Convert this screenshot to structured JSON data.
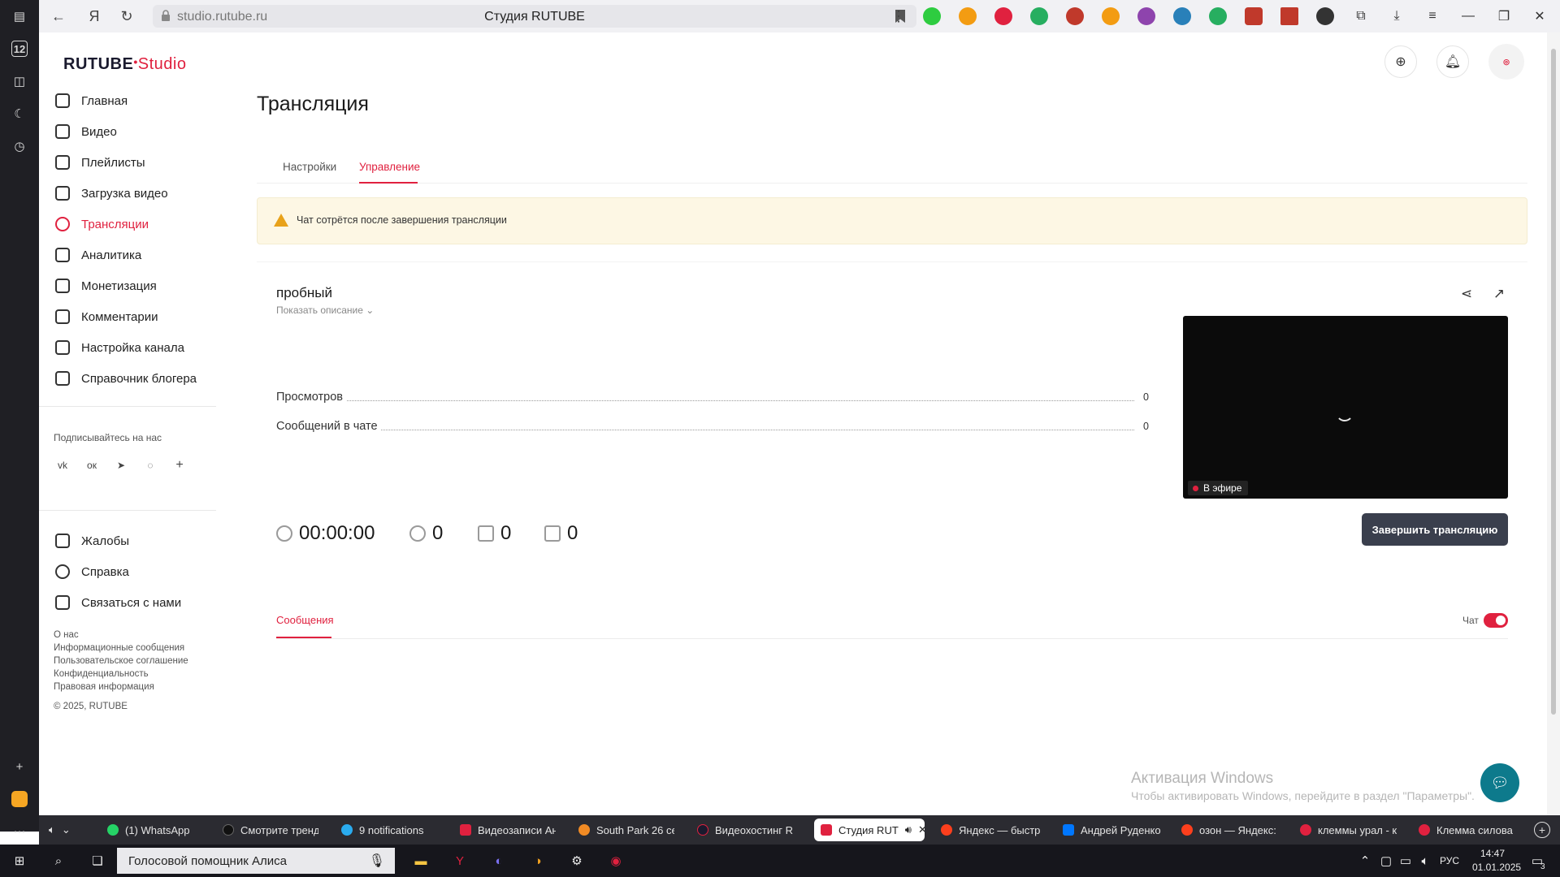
{
  "browser": {
    "url": "studio.rutube.ru",
    "title": "Студия RUTUBE",
    "rail_number": "12"
  },
  "logo": {
    "main": "RUTUBE",
    "suffix": "Studio"
  },
  "sidebar": {
    "items": [
      {
        "label": "Главная",
        "icon": "home-icon"
      },
      {
        "label": "Видео",
        "icon": "video-icon"
      },
      {
        "label": "Плейлисты",
        "icon": "playlist-icon"
      },
      {
        "label": "Загрузка видео",
        "icon": "upload-icon"
      },
      {
        "label": "Трансляции",
        "icon": "broadcast-icon",
        "active": true
      },
      {
        "label": "Аналитика",
        "icon": "analytics-icon"
      },
      {
        "label": "Монетизация",
        "icon": "monetization-icon"
      },
      {
        "label": "Комментарии",
        "icon": "comments-icon"
      },
      {
        "label": "Настройка канала",
        "icon": "settings-icon"
      },
      {
        "label": "Справочник блогера",
        "icon": "guide-icon"
      }
    ],
    "follow_title": "Подписывайтесь на нас",
    "social": [
      "vk",
      "ok",
      "telegram",
      "viber",
      "+"
    ],
    "bottom_items": [
      {
        "label": "Жалобы",
        "icon": "flag-icon"
      },
      {
        "label": "Справка",
        "icon": "help-icon"
      },
      {
        "label": "Связаться с нами",
        "icon": "mail-icon"
      }
    ],
    "footer_links": [
      "О нас",
      "Информационные сообщения",
      "Пользовательское соглашение",
      "Конфиденциальность",
      "Правовая информация"
    ],
    "copyright": "© 2025, RUTUBE"
  },
  "main": {
    "title": "Трансляция",
    "tabs": [
      "Настройки",
      "Управление"
    ],
    "active_tab": "Управление",
    "warning": "Чат сотрётся после завершения трансляции",
    "stream": {
      "name": "пробный",
      "show_description": "Показать описание",
      "stats": [
        {
          "label": "Просмотров",
          "value": "0"
        },
        {
          "label": "Сообщений в чате",
          "value": "0"
        }
      ],
      "duration": "00:00:00",
      "viewers": "0",
      "likes": "0",
      "dislikes": "0",
      "live_badge": "В эфире",
      "end_button": "Завершить трансляцию"
    },
    "messages": {
      "tab": "Сообщения",
      "chat_label": "Чат",
      "chat_enabled": true
    }
  },
  "watermark": {
    "line1": "Активация Windows",
    "line2": "Чтобы активировать Windows, перейдите в раздел \"Параметры\"."
  },
  "browser_tabs": [
    {
      "label": "(1) WhatsApp",
      "color": "#25d366"
    },
    {
      "label": "Смотрите тренд",
      "color": "#111111"
    },
    {
      "label": "9 notifications",
      "color": "#2aabee"
    },
    {
      "label": "Видеозаписи Ан",
      "color": "#e0213f"
    },
    {
      "label": "South Park 26 се",
      "color": "#f08a24"
    },
    {
      "label": "Видеохостинг RU",
      "color": "#1a1a2e"
    },
    {
      "label": "Студия RUT",
      "color": "#e0213f",
      "active": true
    },
    {
      "label": "Яндекс — быстр",
      "color": "#fc3f1d"
    },
    {
      "label": "Андрей Руденко",
      "color": "#0077ff"
    },
    {
      "label": "озон — Яндекс:",
      "color": "#fc3f1d"
    },
    {
      "label": "клеммы урал - к",
      "color": "#e0213f"
    },
    {
      "label": "Клемма силова",
      "color": "#e0213f"
    }
  ],
  "taskbar": {
    "assistant": "Голосовой помощник Алиса",
    "lang": "РУС",
    "time": "14:47",
    "date": "01.01.2025",
    "notifications": "3"
  },
  "colors": {
    "accent": "#e0213f",
    "end_button": "#3a3f4d",
    "warning_bg": "#fdf7e4"
  }
}
